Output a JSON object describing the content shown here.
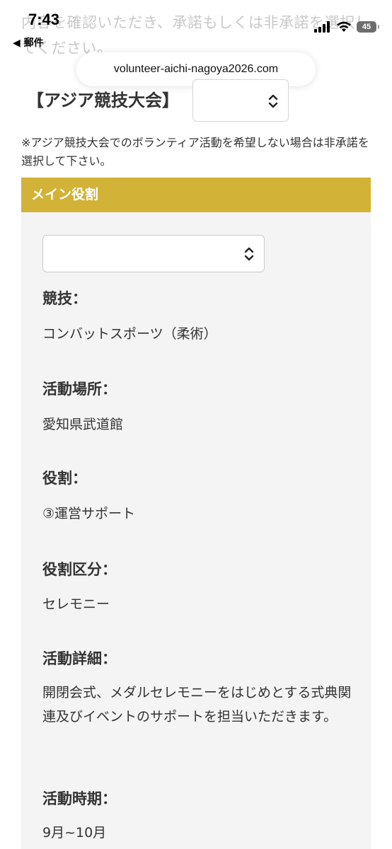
{
  "background_text": "内容を確認いただき、承諾もしくは非承諾を選択してください。",
  "status_bar": {
    "time": "7:43",
    "back_label": "◀ 郵件",
    "battery": "45"
  },
  "browser": {
    "url": "volunteer-aichi-nagoya2026.com"
  },
  "asian_games": {
    "label": "【アジア競技大会】",
    "selected_value": ""
  },
  "note": "※アジア競技大会でのボランティア活動を希望しない場合は非承諾を選択して下さい。",
  "main_role": {
    "header": "メイン役割",
    "selected_value": "",
    "fields": [
      {
        "label": "競技：",
        "value": "コンバットスポーツ（柔術）"
      },
      {
        "label": "活動場所：",
        "value": "愛知県武道館"
      },
      {
        "label": "役割：",
        "value": "③運営サポート"
      },
      {
        "label": "役割区分：",
        "value": "セレモニー"
      },
      {
        "label": "活動詳細：",
        "value": "開閉会式、メダルセレモニーをはじめとする式典関連及びイベントのサポートを担当いただきます。"
      },
      {
        "label": "活動時期：",
        "value": "9月~10月"
      }
    ]
  }
}
